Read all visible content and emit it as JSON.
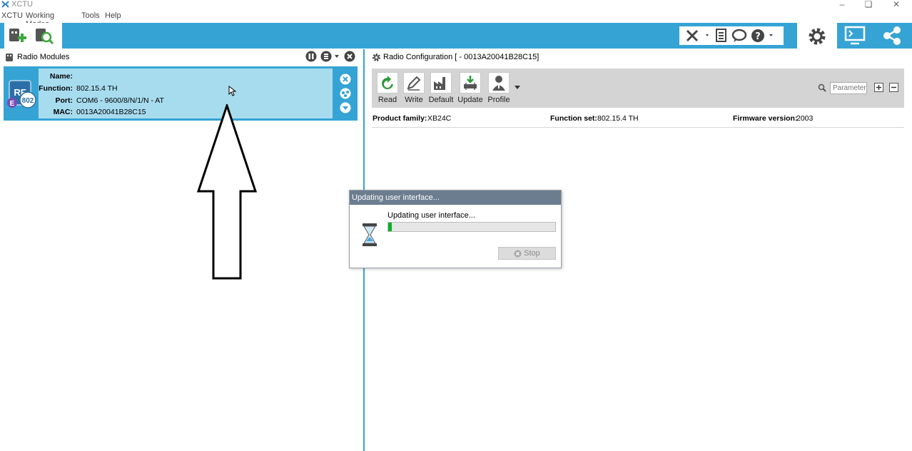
{
  "app": {
    "title": "XCTU"
  },
  "menu": {
    "items": [
      "XCTU",
      "Working Modes",
      "Tools",
      "Help"
    ]
  },
  "toolbar": {
    "left_icons": [
      "add-module-icon",
      "discover-modules-icon"
    ],
    "right_group_icons": [
      "tools-icon",
      "xbee-profile-icon",
      "feedback-icon",
      "help-icon"
    ],
    "mode_icons": [
      "configuration-mode-icon",
      "consoles-mode-icon",
      "network-mode-icon"
    ]
  },
  "left_panel": {
    "title": "Radio Modules",
    "module": {
      "badge_top": "RF",
      "badge_e": "E",
      "badge_num": "802",
      "name_label": "Name:",
      "name_value": "",
      "function_label": "Function:",
      "function_value": "802.15.4 TH",
      "port_label": "Port:",
      "port_value": "COM6 - 9600/8/N/1/N - AT",
      "mac_label": "MAC:",
      "mac_value": "0013A20041B28C15"
    }
  },
  "right_panel": {
    "title": "Radio Configuration [  - 0013A20041B28C15]",
    "buttons": {
      "read": "Read",
      "write": "Write",
      "default": "Default",
      "update": "Update",
      "profile": "Profile"
    },
    "search_placeholder": "Parameter",
    "info": {
      "product_family_label": "Product family:",
      "product_family_value": "XB24C",
      "function_set_label": "Function set:",
      "function_set_value": "802.15.4 TH",
      "firmware_label": "Firmware version:",
      "firmware_value": "2003"
    }
  },
  "dialog": {
    "title": "Updating user interface...",
    "message": "Updating user interface...",
    "progress": 0.02,
    "stop_label": "Stop"
  },
  "colors": {
    "accent": "#35a4d5",
    "module_fill": "#a7dcef",
    "progress": "#06b025",
    "dialog_title": "#6c7d8f"
  }
}
